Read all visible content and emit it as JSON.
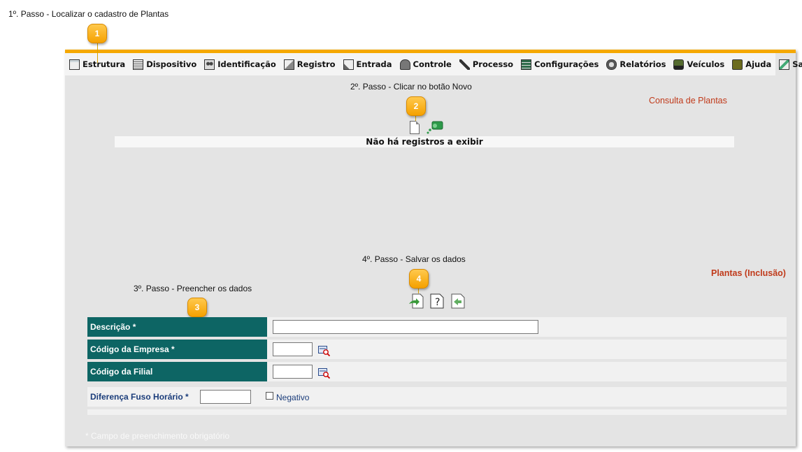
{
  "steps": {
    "step1": "1º. Passo - Localizar o cadastro de Plantas",
    "step2": "2º. Passo - Clicar no botão Novo",
    "step3": "3º. Passo - Preencher os dados",
    "step4": "4º. Passo - Salvar os dados"
  },
  "callouts": [
    "1",
    "2",
    "3",
    "4"
  ],
  "menu": [
    {
      "label": "Estrutura",
      "icon": "structure-icon"
    },
    {
      "label": "Dispositivo",
      "icon": "device-icon"
    },
    {
      "label": "Identificação",
      "icon": "people-icon"
    },
    {
      "label": "Registro",
      "icon": "register-icon"
    },
    {
      "label": "Entrada",
      "icon": "entry-icon"
    },
    {
      "label": "Controle",
      "icon": "control-icon"
    },
    {
      "label": "Processo",
      "icon": "tools-icon"
    },
    {
      "label": "Configurações",
      "icon": "settings-icon"
    },
    {
      "label": "Relatórios",
      "icon": "lock-report-icon"
    },
    {
      "label": "Veículos",
      "icon": "vehicle-icon"
    },
    {
      "label": "Ajuda",
      "icon": "help-icon"
    },
    {
      "label": "Sair",
      "icon": "exit-icon"
    }
  ],
  "consulta": {
    "title": "Consulta de Plantas",
    "empty_message": "Não há registros a exibir"
  },
  "inclusao": {
    "title": "Plantas (Inclusão)",
    "fields": {
      "descricao": {
        "label": "Descrição *",
        "value": ""
      },
      "codigo_empresa": {
        "label": "Código da Empresa *",
        "value": ""
      },
      "codigo_filial": {
        "label": "Código da Filial",
        "value": ""
      },
      "fuso": {
        "label": "Diferença Fuso Horário *",
        "value": "",
        "checkbox_label": "Negativo",
        "checked": false
      }
    },
    "footnote": "* Campo de preenchimento obrigatório"
  },
  "colors": {
    "accent": "#f5a800",
    "label_bg": "#0d6564",
    "title_red": "#c03a1a",
    "link_blue": "#1a3c7a"
  }
}
